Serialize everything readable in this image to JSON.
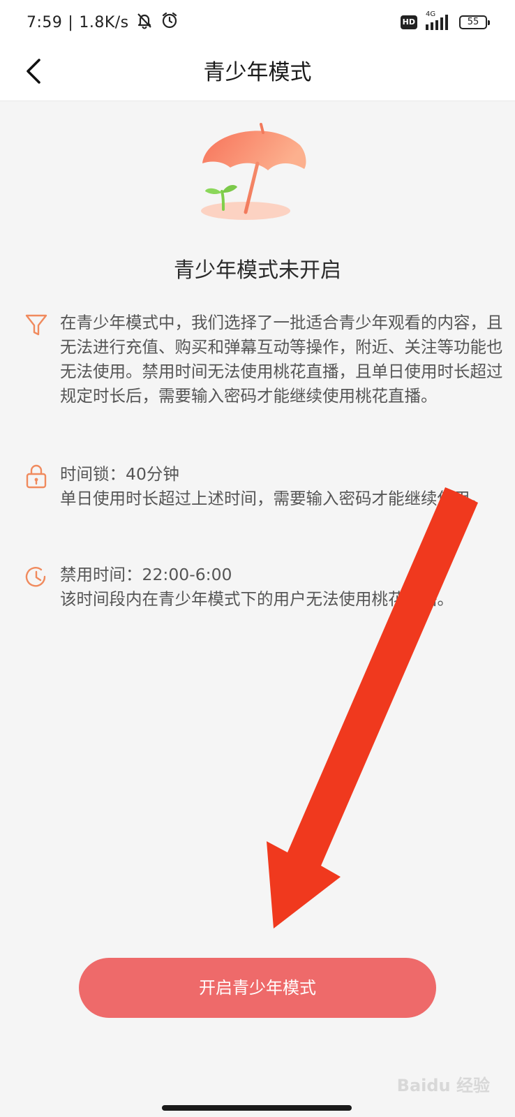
{
  "status_bar": {
    "time": "7:59",
    "separator": "|",
    "net_speed": "1.8K/s",
    "hd_label": "HD",
    "network_type": "4G",
    "battery": "55"
  },
  "header": {
    "back_icon": "chevron-left-icon",
    "title": "青少年模式"
  },
  "hero": {
    "icon": "umbrella-sprout-illustration"
  },
  "status_title": "青少年模式未开启",
  "info": [
    {
      "icon": "filter-icon",
      "text": "在青少年模式中，我们选择了一批适合青少年观看的内容，且无法进行充值、购买和弹幕互动等操作，附近、关注等功能也无法使用。禁用时间无法使用桃花直播，且单日使用时长超过规定时长后，需要输入密码才能继续使用桃花直播。"
    },
    {
      "icon": "lock-icon",
      "title": "时间锁：40分钟",
      "text": "单日使用时长超过上述时间，需要输入密码才能继续使用。"
    },
    {
      "icon": "clock-icon",
      "title": "禁用时间：22:00-6:00",
      "text": "该时间段内在青少年模式下的用户无法使用桃花直播。"
    }
  ],
  "cta": {
    "label": "开启青少年模式"
  },
  "watermark": "Baidu 经验",
  "colors": {
    "accent": "#ee6a6a",
    "icon_orange": "#f08a5d",
    "annotation_arrow": "#f0391e"
  }
}
